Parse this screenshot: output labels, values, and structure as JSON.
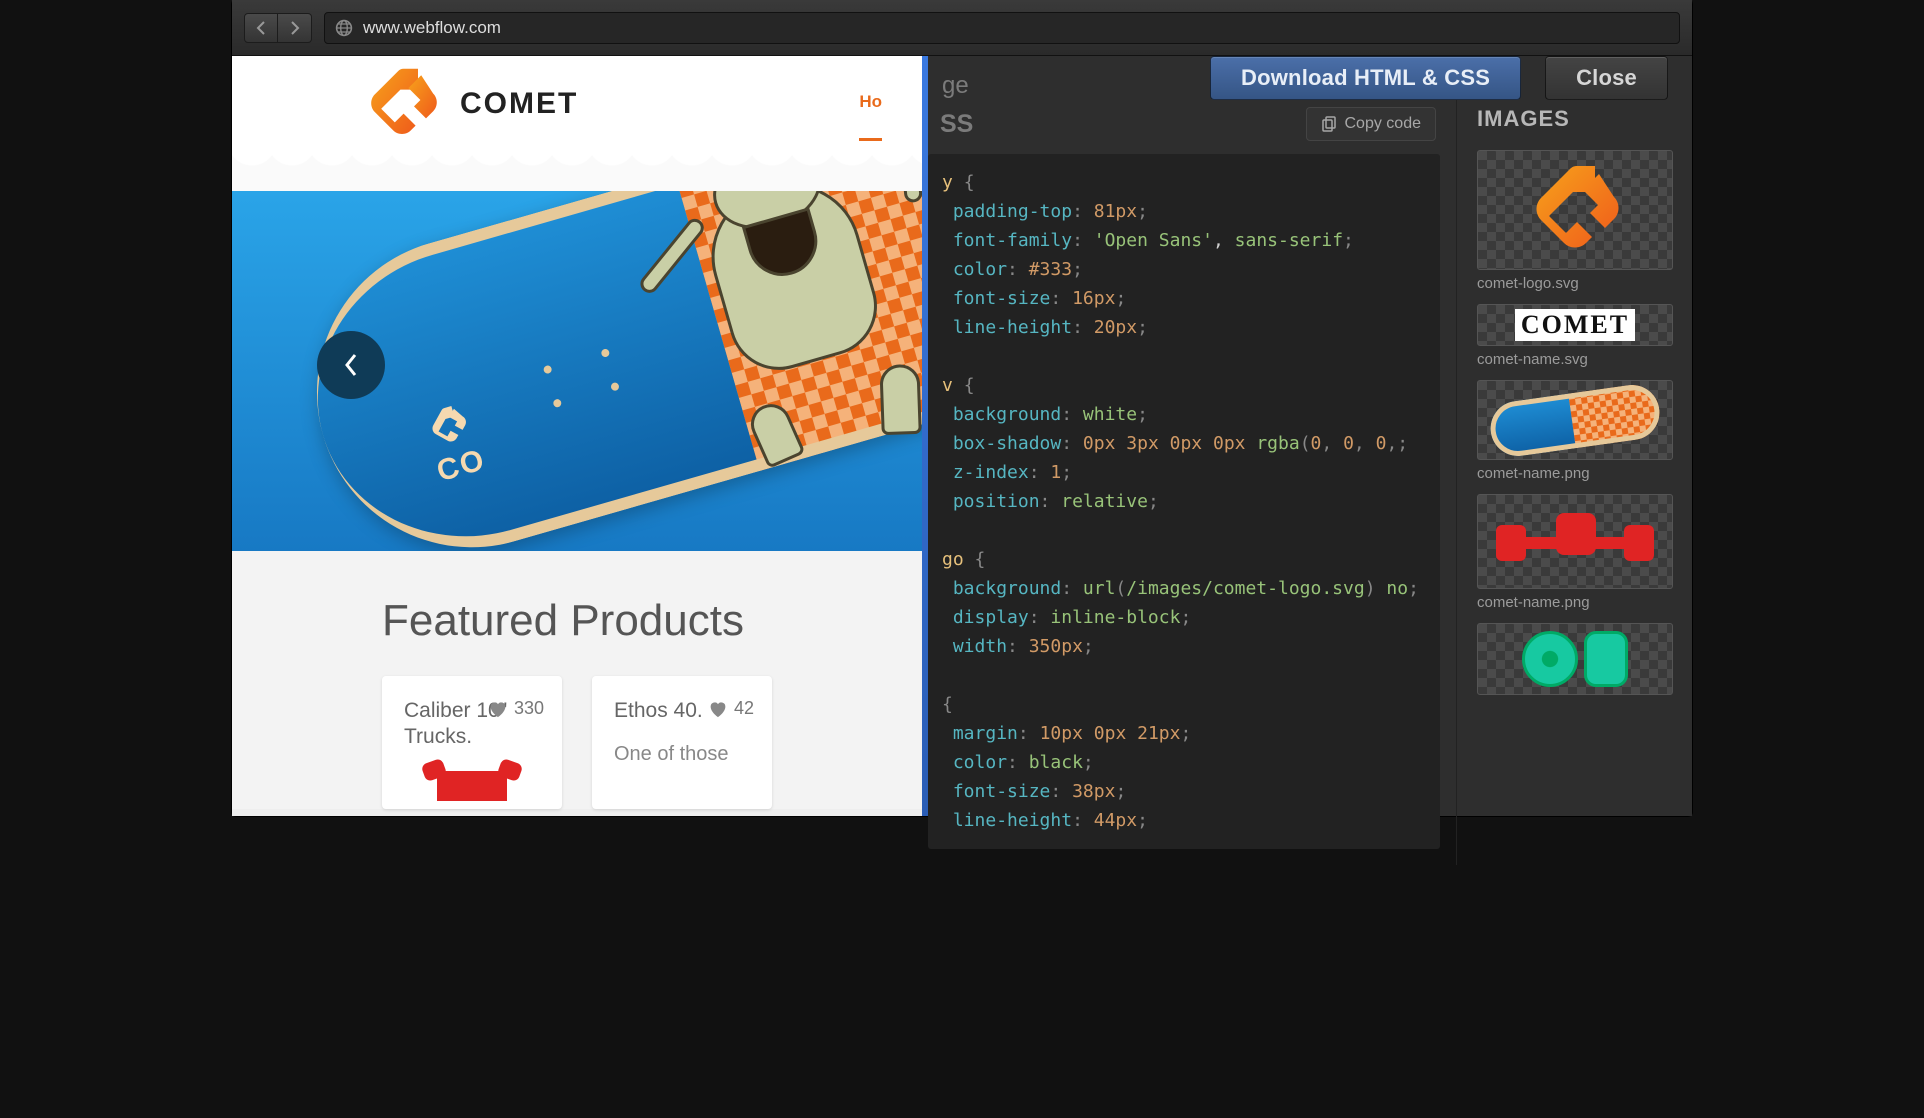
{
  "browser": {
    "url": "www.webflow.com"
  },
  "export_panel": {
    "title_fragment": "ge",
    "download_label": "Download HTML & CSS",
    "close_label": "Close",
    "code_tab_label": "SS",
    "copy_label": "Copy code",
    "images_heading": "IMAGES"
  },
  "site": {
    "brand_word": "COMET",
    "nav_home": "Ho",
    "featured_heading": "Featured Products",
    "products": [
      {
        "name": "Caliber 10\" Trucks.",
        "likes": "330"
      },
      {
        "name": "Ethos 40.",
        "likes": "42",
        "blurb": "One of those"
      }
    ]
  },
  "assets": [
    {
      "file": "comet-logo.svg",
      "kind": "logo"
    },
    {
      "file": "comet-name.svg",
      "kind": "word"
    },
    {
      "file": "comet-name.png",
      "kind": "board"
    },
    {
      "file": "comet-name.png",
      "kind": "trucks"
    },
    {
      "file": "",
      "kind": "wheels"
    }
  ],
  "css_code": {
    "rules": [
      {
        "sel": "y",
        "decls": [
          [
            "padding-top",
            "81px"
          ],
          [
            "font-family",
            "'Open Sans', sans-serif"
          ],
          [
            "color",
            "#333"
          ],
          [
            "font-size",
            "16px"
          ],
          [
            "line-height",
            "20px"
          ]
        ]
      },
      {
        "sel": "v",
        "decls": [
          [
            "background",
            "white"
          ],
          [
            "box-shadow",
            "0px 3px 0px 0px rgba(0, 0, 0,"
          ],
          [
            "z-index",
            "1"
          ],
          [
            "position",
            "relative"
          ]
        ]
      },
      {
        "sel": "go",
        "decls": [
          [
            "background",
            "url(/images/comet-logo.svg) no"
          ],
          [
            "display",
            "inline-block"
          ],
          [
            "width",
            "350px"
          ]
        ]
      },
      {
        "sel": "",
        "decls": [
          [
            "margin",
            "10px 0px 21px"
          ],
          [
            "color",
            "black"
          ],
          [
            "font-size",
            "38px"
          ],
          [
            "line-height",
            "44px"
          ]
        ]
      }
    ]
  }
}
